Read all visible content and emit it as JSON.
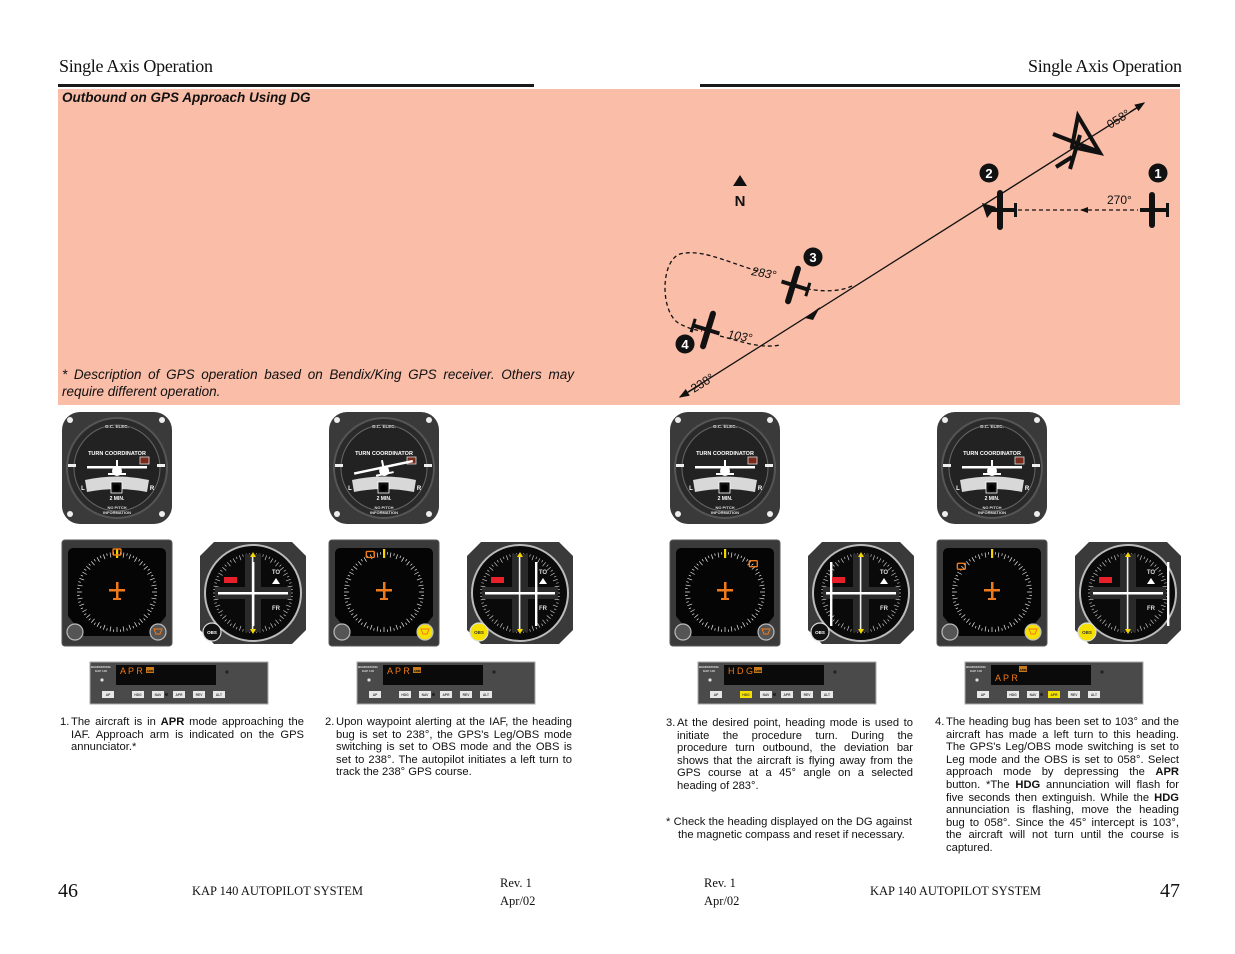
{
  "left_page": {
    "header_title": "Single Axis Operation",
    "page_number": "46",
    "footer_system": "KAP 140 AUTOPILOT SYSTEM",
    "footer_rev": "Rev. 1",
    "footer_date": "Apr/02"
  },
  "right_page": {
    "header_title": "Single Axis Operation",
    "page_number": "47",
    "footer_system": "KAP 140 AUTOPILOT SYSTEM",
    "footer_rev": "Rev. 1",
    "footer_date": "Apr/02"
  },
  "panel": {
    "title": "Outbound on GPS Approach Using DG",
    "footnote": "* Description of GPS operation based on Bendix/King GPS receiver. Others may require different operation.",
    "background_color": "#f9bda8"
  },
  "diagram": {
    "north_label": "N",
    "headings": {
      "h058": "058°",
      "h270": "270°",
      "h283": "283°",
      "h103": "103°",
      "h238": "238°"
    },
    "markers": [
      "1",
      "2",
      "3",
      "4"
    ]
  },
  "instrument_labels": {
    "tc_top": "D.C. ELEC.",
    "tc_title": "TURN COORDINATOR",
    "tc_left": "L",
    "tc_right": "R",
    "tc_min": "2 MIN.",
    "tc_no_pitch_1": "NO PITCH",
    "tc_no_pitch_2": "INFORMATION",
    "cdi_to": "TO",
    "cdi_fr": "FR",
    "cdi_knob": "OBS",
    "ap_brand_1": "BENDIX/KING",
    "ap_brand_2": "KAP 140",
    "ap_buttons": [
      "AP",
      "HDG",
      "NAV",
      "APR",
      "REV",
      "ALT"
    ]
  },
  "steps": [
    {
      "num": "1.",
      "text_html": "The aircraft is in <b>APR</b> mode approaching the IAF. Approach arm is indicated on the GPS annunciator.*",
      "ap_display": "APR",
      "ap_display_secondary": "",
      "ap_arm": "ARM",
      "active_button": "",
      "obs_yellow": false
    },
    {
      "num": "2.",
      "text_html": "Upon waypoint alerting at the IAF, the heading bug is set to 238°, the GPS's Leg/OBS mode switching is set to OBS mode and the OBS is set to 238°. The autopilot initiates a left turn to track the 238° GPS course.",
      "ap_display": "APR",
      "ap_display_secondary": "",
      "ap_arm": "ARM",
      "active_button": "",
      "obs_yellow": true
    },
    {
      "num": "3.",
      "text_html": "At the desired point, heading mode is used to initiate the procedure turn. During the procedure turn outbound, the deviation bar shows that the aircraft is flying away from the GPS course at a 45° angle on a selected heading of 283°.",
      "ap_display": "HDG",
      "ap_display_secondary": "",
      "ap_arm": "ARM",
      "active_button": "HDG",
      "obs_yellow": false
    },
    {
      "num": "4.",
      "text_html": "The heading bug has been set to 103° and the aircraft has made a left turn to this heading. The GPS's Leg/OBS mode switching is set to Leg mode and the OBS is set to 058°. Select approach mode by depressing the <b>APR</b> button. *The <b>HDG</b> annunciation will flash for five seconds then extinguish. While the <b>HDG</b> annunciation is flashing, move the heading bug to 058°. Since the 45° intercept is 103°, the aircraft will not turn until the course is captured.",
      "ap_display": "APR",
      "ap_display_secondary": "",
      "ap_arm": "ARM",
      "active_button": "APR",
      "obs_yellow": true
    }
  ],
  "step3_note": "* Check the heading displayed on the DG against the magnetic compass and reset if necessary."
}
